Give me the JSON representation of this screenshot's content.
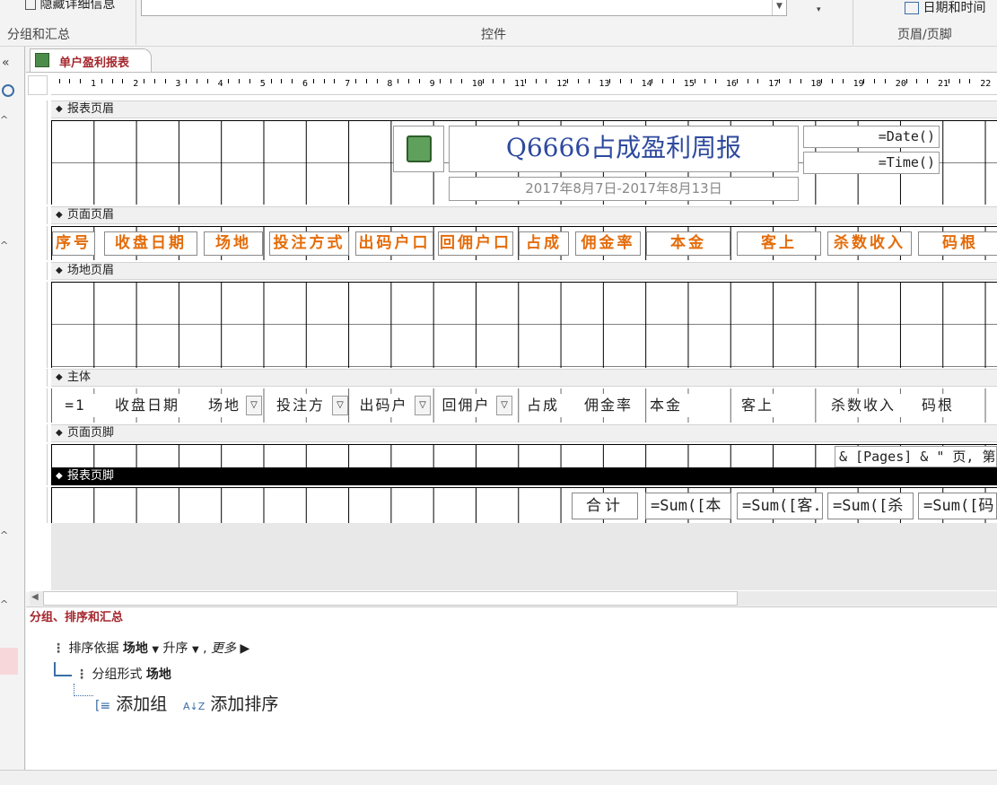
{
  "ribbon": {
    "hide_details_label": "隐藏详细信息",
    "date_time_label": "日期和时间",
    "groups": {
      "grouping": "分组和汇总",
      "controls": "控件",
      "header_footer": "页眉/页脚"
    }
  },
  "tab": {
    "label": "单户盈利报表"
  },
  "ruler": {
    "marks": [
      "1",
      "2",
      "3",
      "4",
      "5",
      "6",
      "7",
      "8",
      "9",
      "10",
      "11",
      "12",
      "13",
      "14",
      "15",
      "16",
      "17",
      "18",
      "19",
      "20",
      "21",
      "22"
    ]
  },
  "sections": {
    "report_header": "报表页眉",
    "page_header": "页面页眉",
    "venue_header": "场地页眉",
    "detail": "主体",
    "page_footer": "页面页脚",
    "report_footer": "报表页脚"
  },
  "report_header": {
    "title": "Q6666占成盈利周报",
    "subtitle": "2017年8月7日-2017年8月13日",
    "date_expr": "=Date()",
    "time_expr": "=Time()"
  },
  "page_header": {
    "columns": [
      "序号",
      "收盘日期",
      "场地",
      "投注方式",
      "出码户口",
      "回佣户口",
      "占成",
      "佣金率",
      "本金",
      "客上",
      "杀数收入",
      "码根"
    ]
  },
  "detail": {
    "fields": [
      "=1",
      "收盘日期",
      "场地",
      "投注方",
      "出码户",
      "回佣户",
      "占成",
      "佣金率",
      "本金",
      "客上",
      "杀数收入",
      "码根"
    ]
  },
  "page_footer": {
    "page_expr": "& [Pages] & \" 页, 第"
  },
  "report_footer": {
    "total_label": "合计",
    "sums": [
      "=Sum([本",
      "=Sum([客.",
      "=Sum([杀",
      "=Sum([码"
    ]
  },
  "group_pane": {
    "title": "分组、排序和汇总",
    "sort_prefix": "排序依据",
    "sort_field": "场地",
    "sort_order": "升序",
    "more": "更多 ▶",
    "group_prefix": "分组形式",
    "group_field": "场地",
    "add_group": "添加组",
    "add_sort": "添加排序"
  }
}
